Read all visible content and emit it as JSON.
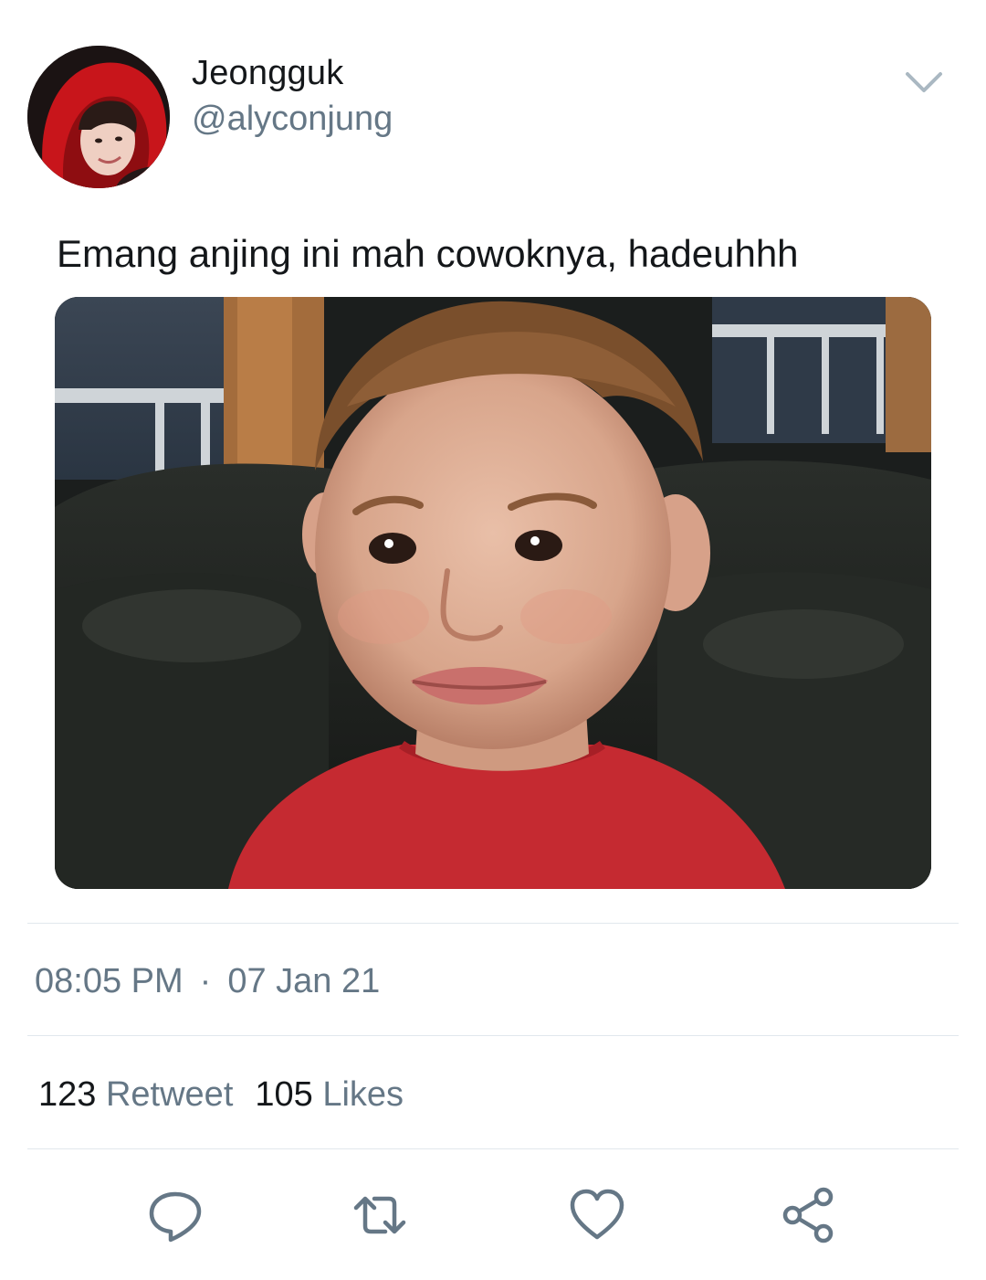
{
  "tweet": {
    "author": {
      "display_name": "Jeongguk",
      "handle": "@alyconjung"
    },
    "text": "Emang anjing ini mah cowoknya, hadeuhhh",
    "media": {
      "description_icon": "photo"
    },
    "meta": {
      "time": "08:05 PM",
      "separator": "·",
      "date": "07 Jan 21"
    },
    "stats": {
      "retweet_count": "123",
      "retweet_label": "Retweet",
      "like_count": "105",
      "like_label": "Likes"
    }
  },
  "colors": {
    "text_primary": "#14171a",
    "text_secondary": "#657786",
    "icon": "#657786",
    "divider": "#e1e8ed",
    "avatar_hood": "#c8151b"
  },
  "icons": {
    "menu": "chevron-down-icon",
    "reply": "reply-icon",
    "retweet": "retweet-icon",
    "like": "heart-icon",
    "share": "share-icon"
  }
}
